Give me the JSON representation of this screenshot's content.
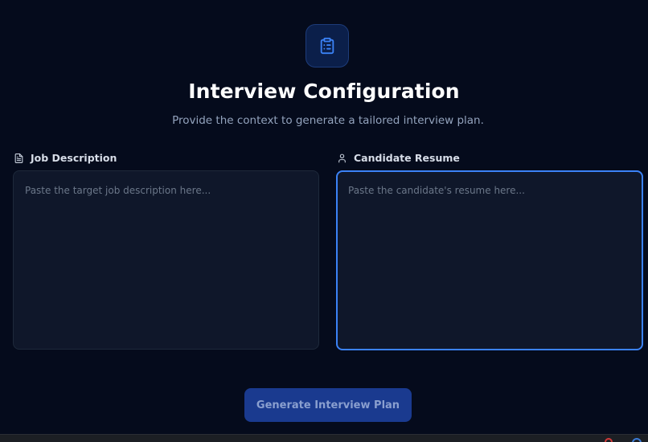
{
  "header": {
    "icon": "clipboard-list-icon",
    "title": "Interview Configuration",
    "subtitle": "Provide the context to generate a tailored interview plan."
  },
  "fields": {
    "job_description": {
      "icon": "file-text-icon",
      "label": "Job Description",
      "placeholder": "Paste the target job description here...",
      "value": ""
    },
    "candidate_resume": {
      "icon": "user-icon",
      "label": "Candidate Resume",
      "placeholder": "Paste the candidate's resume here...",
      "value": ""
    }
  },
  "actions": {
    "generate_label": "Generate Interview Plan"
  },
  "colors": {
    "background": "#050b1c",
    "accent": "#3b82f6",
    "button": "#1a3a8f",
    "input_bg": "#0f172a"
  }
}
